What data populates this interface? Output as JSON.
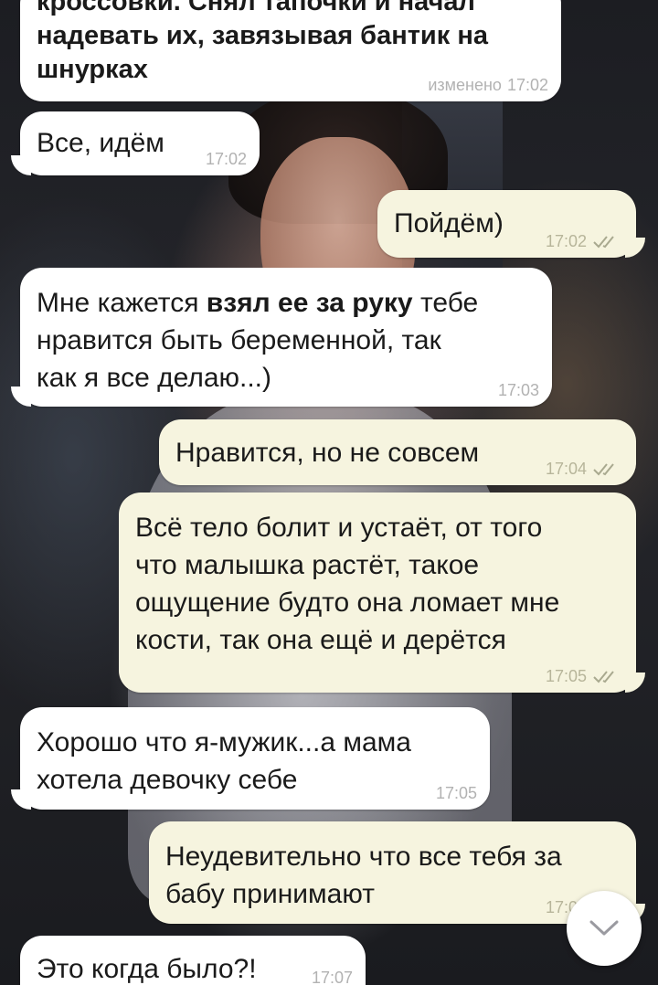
{
  "messages": [
    {
      "direction": "in",
      "text_line_cut": "кроссовки. Снял тапочки и начал",
      "text": "надевать их, завязывая бантик на\nшнурках",
      "edited_label": "изменено",
      "time": "17:02"
    },
    {
      "direction": "in",
      "text": "Все, идём",
      "time": "17:02"
    },
    {
      "direction": "out",
      "text": "Пойдём)",
      "time": "17:02",
      "status": "read"
    },
    {
      "direction": "in",
      "text_before": "Мне кажется ",
      "text_bold": "взял ее за руку",
      "text_after": " тебе\nнравится быть беременной, так\nкак я все делаю...)",
      "time": "17:03"
    },
    {
      "direction": "out",
      "text": "Нравится, но не совсем",
      "time": "17:04",
      "status": "read"
    },
    {
      "direction": "out",
      "text": "Всё тело болит и устаёт, от того\nчто малышка растёт, такое\nощущение будто она ломает мне\nкости, так она ещё и дерётся",
      "time": "17:05",
      "status": "read"
    },
    {
      "direction": "in",
      "text": "Хорошо что я-мужик...а мама\nхотела девочку себе",
      "time": "17:05"
    },
    {
      "direction": "out",
      "text": "Неудевительно что все тебя за\nбабу принимают",
      "time": "17:06",
      "status": "read"
    },
    {
      "direction": "in",
      "text": "Это когда было?!",
      "time": "17:07"
    }
  ],
  "scroll_button": {
    "icon": "chevron-down-icon"
  },
  "colors": {
    "incoming": "#ffffff",
    "outgoing": "#f6f4df",
    "read_ticks": "#a9a98f"
  }
}
